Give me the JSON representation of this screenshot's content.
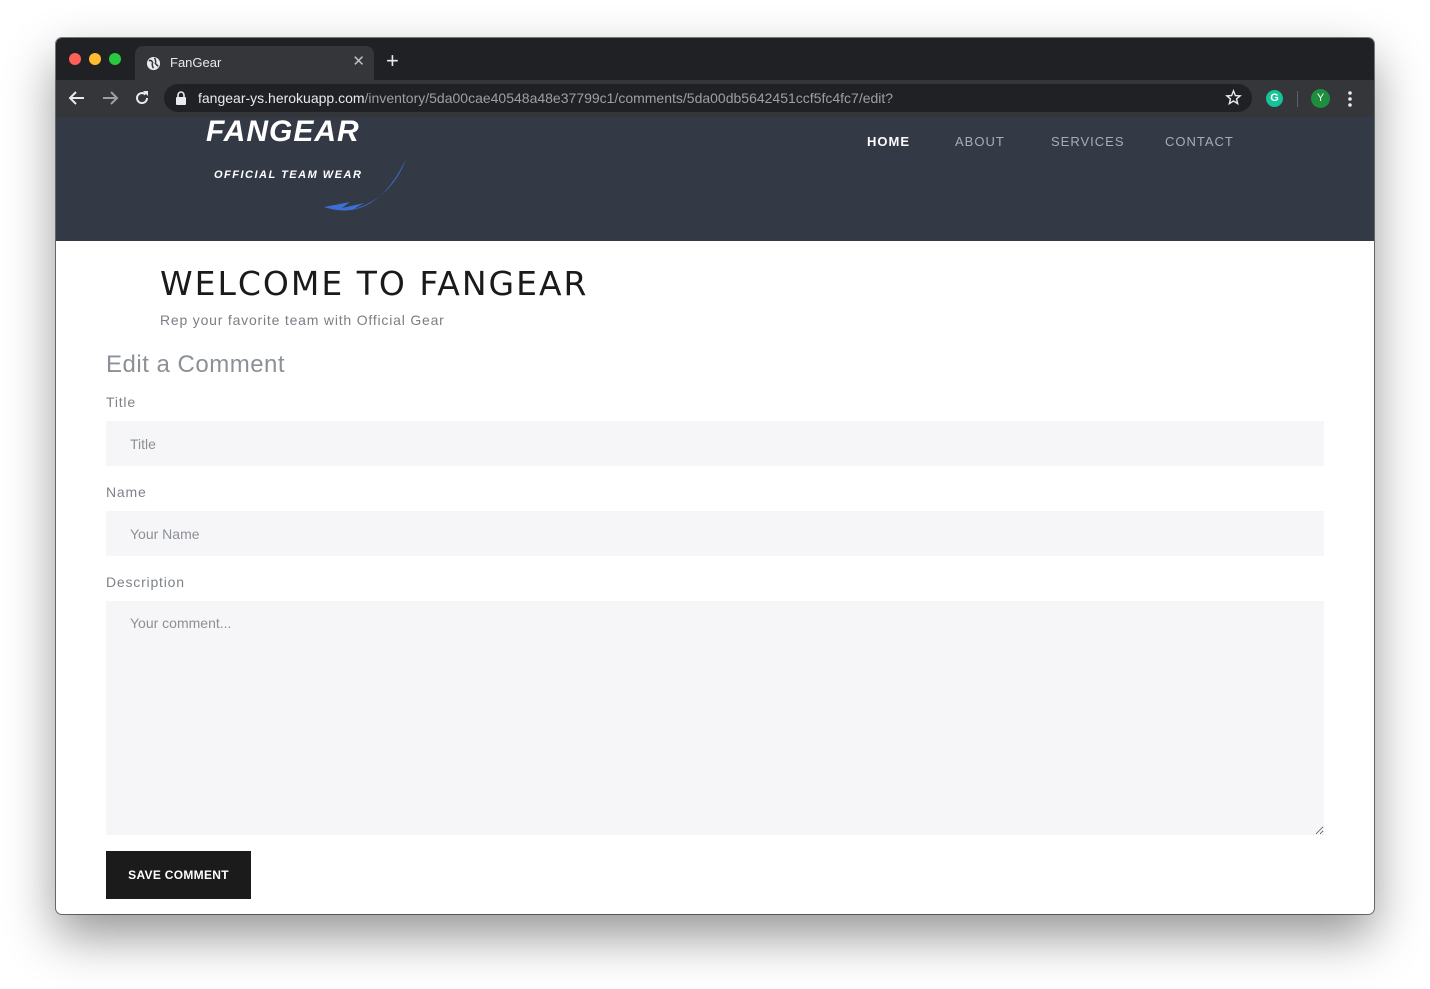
{
  "browser": {
    "tab_title": "FanGear",
    "url_host": "fangear-ys.herokuapp.com",
    "url_path": "/inventory/5da00cae40548a48e37799c1/comments/5da00db5642451ccf5fc4fc7/edit?",
    "profile_initial": "Y",
    "extension_letter": "G"
  },
  "site": {
    "logo_text": "FANGEAR",
    "logo_tagline": "OFFICIAL TEAM WEAR",
    "nav": [
      "HOME",
      "ABOUT",
      "SERVICES",
      "CONTACT"
    ],
    "active_nav": "HOME"
  },
  "hero": {
    "title": "WELCOME TO FANGEAR",
    "subtitle": "Rep your favorite team with Official Gear"
  },
  "form": {
    "heading": "Edit a Comment",
    "title_label": "Title",
    "title_placeholder": "Title",
    "title_value": "",
    "name_label": "Name",
    "name_placeholder": "Your Name",
    "name_value": "",
    "description_label": "Description",
    "description_placeholder": "Your comment...",
    "description_value": "",
    "submit_label": "SAVE COMMENT"
  },
  "colors": {
    "header_bg": "#343a45",
    "accent_blue": "#3b6fd1",
    "button_bg": "#1b1b1b"
  }
}
